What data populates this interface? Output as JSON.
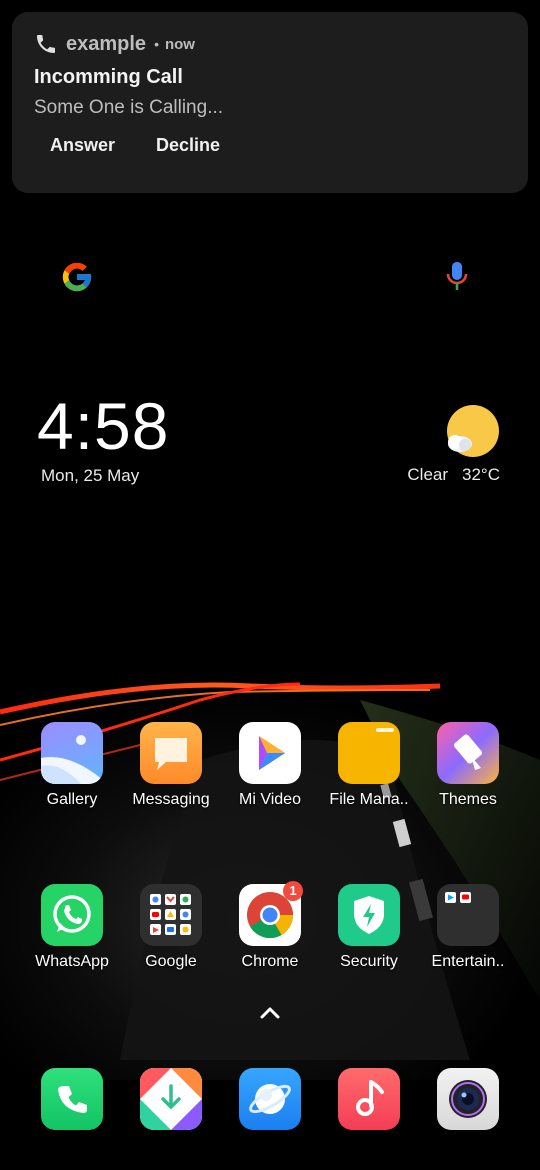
{
  "notification": {
    "app_name": "example",
    "separator": "•",
    "time": "now",
    "title": "Incomming Call",
    "text": "Some One is Calling...",
    "actions": [
      "Answer",
      "Decline"
    ]
  },
  "clock": {
    "time": "4:58",
    "date": "Mon, 25 May"
  },
  "weather": {
    "condition": "Clear",
    "temperature": "32°C"
  },
  "apps_row1": [
    {
      "label": "Gallery",
      "icon": "gallery-icon"
    },
    {
      "label": "Messaging",
      "icon": "messaging-icon"
    },
    {
      "label": "Mi Video",
      "icon": "mi-video-icon"
    },
    {
      "label": "File Mana..",
      "icon": "file-manager-icon"
    },
    {
      "label": "Themes",
      "icon": "themes-icon"
    }
  ],
  "apps_row2": [
    {
      "label": "WhatsApp",
      "icon": "whatsapp-icon"
    },
    {
      "label": "Google",
      "icon": "google-folder-icon"
    },
    {
      "label": "Chrome",
      "icon": "chrome-icon",
      "badge": "1"
    },
    {
      "label": "Security",
      "icon": "security-icon"
    },
    {
      "label": "Entertain..",
      "icon": "entertainment-folder-icon"
    }
  ],
  "dock": [
    {
      "icon": "phone-icon"
    },
    {
      "icon": "mi-store-icon"
    },
    {
      "icon": "browser-icon"
    },
    {
      "icon": "music-icon"
    },
    {
      "icon": "camera-icon"
    }
  ],
  "colors": {
    "notification_bg": "#1d1d1d",
    "badge": "#f34a3e",
    "wallpaper_streak": "#ff3b1a"
  }
}
